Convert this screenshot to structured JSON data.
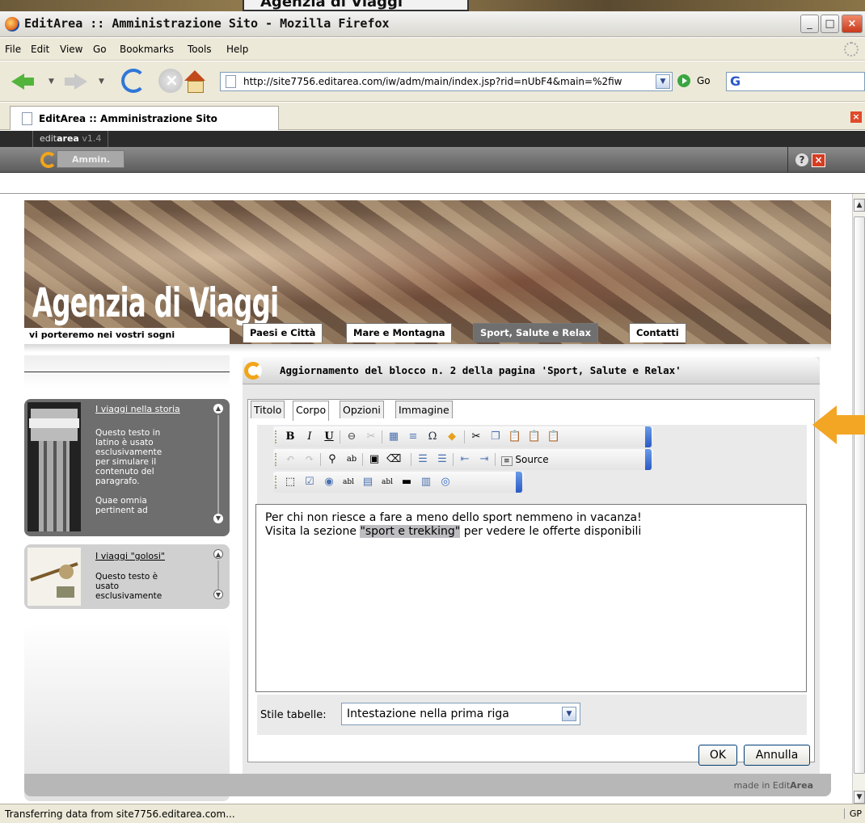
{
  "background_banner": "Agenzia di Viaggi",
  "window": {
    "title": "EditArea :: Amministrazione Sito - Mozilla Firefox"
  },
  "menu": {
    "items": [
      "File",
      "Edit",
      "View",
      "Go",
      "Bookmarks",
      "Tools",
      "Help"
    ]
  },
  "nav": {
    "url": "http://site7756.editarea.com/iw/adm/main/index.jsp?rid=nUbF4&main=%2fiw",
    "go_label": "Go",
    "search_logo": "G"
  },
  "tab": {
    "label": "EditArea :: Amministrazione Sito"
  },
  "editarea": {
    "brand_bold": "editarea",
    "brand_prefix": "edit",
    "brand_suffix": "area",
    "version": "v1.4",
    "amm_label": "Ammin.",
    "help": "?"
  },
  "site": {
    "title": "Agenzia di Viaggi",
    "subtitle": "vi porteremo nei vostri sogni",
    "menu": [
      "Paesi e Città",
      "Mare e Montagna",
      "Sport, Salute e Relax",
      "Contatti"
    ],
    "active_menu": "Sport, Salute e Relax"
  },
  "sidebar": {
    "cards": [
      {
        "heading": "I viaggi nella storia",
        "body": [
          "Questo testo in",
          "latino è usato",
          "esclusivamente",
          "per simulare il",
          "contenuto del",
          "paragrafo.",
          "",
          "Quae omnia",
          "pertinent ad"
        ]
      },
      {
        "heading": "I viaggi \"golosi\"",
        "body": [
          "Questo testo è",
          "usato",
          "esclusivamente"
        ]
      }
    ]
  },
  "panel": {
    "title": "Aggiornamento del blocco n. 2 della pagina 'Sport, Salute e Relax'",
    "tabs": [
      "Titolo",
      "Corpo",
      "Opzioni",
      "Immagine"
    ],
    "active_tab": "Corpo",
    "toolbar": {
      "source_label": "Source"
    },
    "editor": {
      "line1": "Per chi non riesce a fare a meno dello sport nemmeno in vacanza!",
      "line2_before": "Visita la sezione ",
      "line2_highlight": "\"sport e trekking\"",
      "line2_after": " per vedere le offerte disponibili"
    },
    "stile_label": "Stile tabelle:",
    "stile_value": "Intestazione nella prima riga",
    "ok_label": "OK",
    "cancel_label": "Annulla"
  },
  "footer": {
    "made_in": "made in Edit",
    "made_bold": "Area"
  },
  "status": {
    "text": "Transferring data from site7756.editarea.com...",
    "right": "GP"
  },
  "colors": {
    "accent_arrow": "#f3a524",
    "editarea_orange": "#f1a51a",
    "active_tab_bg": "#6f6f6f"
  }
}
